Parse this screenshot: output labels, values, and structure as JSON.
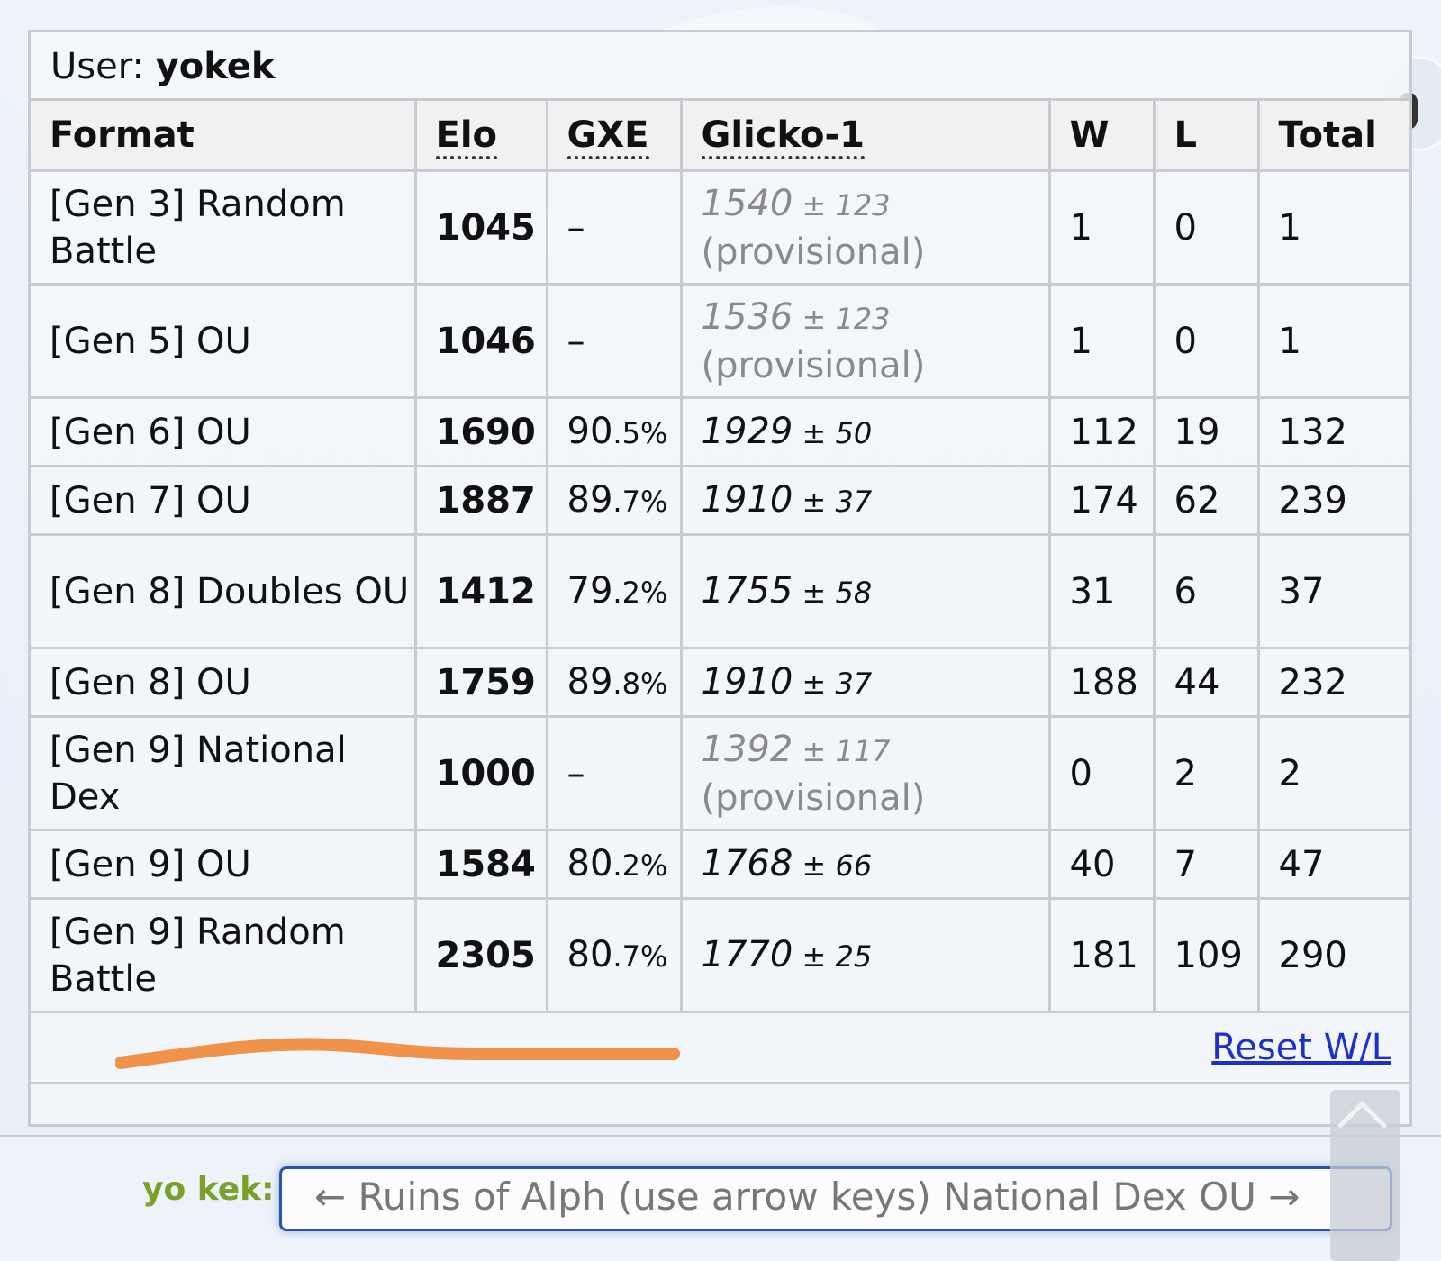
{
  "ladder": {
    "user_label": "User: ",
    "username": "yokek",
    "headers": {
      "format": "Format",
      "elo": "Elo",
      "gxe": "GXE",
      "glicko": "Glicko-1",
      "w": "W",
      "l": "L",
      "total": "Total"
    },
    "rows": [
      {
        "format": "[Gen 3] Random Battle",
        "elo": "1045",
        "gxe_main": "–",
        "gxe_small": "",
        "rating": "1540",
        "sd": "± 123",
        "provisional": "(provisional)",
        "w": "1",
        "l": "0",
        "total": "1"
      },
      {
        "format": "[Gen 5] OU",
        "elo": "1046",
        "gxe_main": "–",
        "gxe_small": "",
        "rating": "1536",
        "sd": "± 123",
        "provisional": "(provisional)",
        "w": "1",
        "l": "0",
        "total": "1"
      },
      {
        "format": "[Gen 6] OU",
        "elo": "1690",
        "gxe_main": "90",
        "gxe_small": ".5%",
        "rating": "1929",
        "sd": "± 50",
        "provisional": "",
        "w": "112",
        "l": "19",
        "total": "132"
      },
      {
        "format": "[Gen 7] OU",
        "elo": "1887",
        "gxe_main": "89",
        "gxe_small": ".7%",
        "rating": "1910",
        "sd": "± 37",
        "provisional": "",
        "w": "174",
        "l": "62",
        "total": "239"
      },
      {
        "format": "[Gen 8] Doubles OU",
        "elo": "1412",
        "gxe_main": "79",
        "gxe_small": ".2%",
        "rating": "1755",
        "sd": "± 58",
        "provisional": "",
        "w": "31",
        "l": "6",
        "total": "37"
      },
      {
        "format": "[Gen 8] OU",
        "elo": "1759",
        "gxe_main": "89",
        "gxe_small": ".8%",
        "rating": "1910",
        "sd": "± 37",
        "provisional": "",
        "w": "188",
        "l": "44",
        "total": "232"
      },
      {
        "format": "[Gen 9] National Dex",
        "elo": "1000",
        "gxe_main": "–",
        "gxe_small": "",
        "rating": "1392",
        "sd": "± 117",
        "provisional": "(provisional)",
        "w": "0",
        "l": "2",
        "total": "2"
      },
      {
        "format": "[Gen 9] OU",
        "elo": "1584",
        "gxe_main": "80",
        "gxe_small": ".2%",
        "rating": "1768",
        "sd": "± 66",
        "provisional": "",
        "w": "40",
        "l": "7",
        "total": "47"
      },
      {
        "format": "[Gen 9] Random Battle",
        "elo": "2305",
        "gxe_main": "80",
        "gxe_small": ".7%",
        "rating": "1770",
        "sd": "± 25",
        "provisional": "",
        "w": "181",
        "l": "109",
        "total": "290"
      }
    ],
    "reset_label": "Reset W/L"
  },
  "chat": {
    "name": "yo kek:",
    "input_text": "← Ruins of Alph (use arrow keys) National Dex OU →"
  },
  "colors": {
    "link": "#1c2fd0",
    "chat_name": "#7aa02a",
    "highlight": "#f0924a",
    "provisional_text": "#8a8a8a",
    "border": "#c8ccd1"
  }
}
